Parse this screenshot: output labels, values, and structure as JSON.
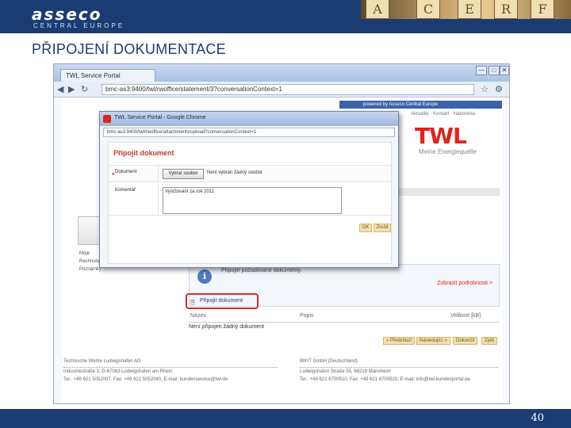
{
  "brand": {
    "logo_text": "asseco",
    "logo_sub": "CENTRAL EUROPE",
    "banner_letters": [
      "A",
      "C",
      "E",
      "R",
      "F"
    ]
  },
  "slide": {
    "title": "PŘIPOJENÍ DOKUMENTACE",
    "page_number": "40"
  },
  "browser": {
    "tab_title": "TWL Service Portal",
    "url": "bmc-as3:9400/twl/rwoffice/statement/3?conversationContext=1",
    "minimize": "—",
    "maximize": "□",
    "close": "✕"
  },
  "portal": {
    "powered_by": "powered by Asseco Central Europe",
    "top_links": "Aktuality · Kontakt · Nápověda",
    "logo": "TWL",
    "tagline": "Meine Energiequelle",
    "info_text": "Připojte požadované dokumenty.",
    "docs_link": "Zobrazit podrobnosti >",
    "attach_link": "Připojit dokument",
    "table_headers": [
      "Název",
      "Popis",
      "Velikost [kB]"
    ],
    "empty_message": "Není připojen žádný dokument",
    "pager": [
      "« Předchozí",
      "Následující »",
      "Dokončit",
      "Zpět"
    ],
    "left_list": [
      "Moje",
      "Rechnungen",
      "Poznámky"
    ],
    "footer_left": [
      "Technische Werke Ludwigshafen AG",
      "Industriestraße 3, D-67063 Ludwigshafen am Rhein",
      "Tel.: +49 621 5052007, Fax: +49 621 5052040, E-mail: kundenservice@twl.de"
    ],
    "footer_right": [
      "BtKIT GmbH (Deutschland)",
      "Ludwigshafen Straße 55, 68219 Mannheim",
      "Tel.: +49 621 6700510, Fax: +49 621 6700520, E-mail: info@twl-kundenportal.de"
    ]
  },
  "popup": {
    "window_title": "TWL Service Portal - Google Chrome",
    "url": "bmc-as3:9400/twl/rwoffice/attachments/upload?conversationContext=1",
    "heading": "Připojit dokument",
    "label_document": "Dokument",
    "choose_button": "Vybrat soubor",
    "file_status": "Není vybrán žádný soubor",
    "label_comment": "Komentář",
    "comment_value": "Vyúčtování za rok 2011",
    "ok_button": "OK",
    "cancel_button": "Zrušit"
  },
  "colors": {
    "brand_blue": "#1a3c73",
    "twl_red": "#e2231a",
    "highlight_red": "#d62b2b"
  }
}
